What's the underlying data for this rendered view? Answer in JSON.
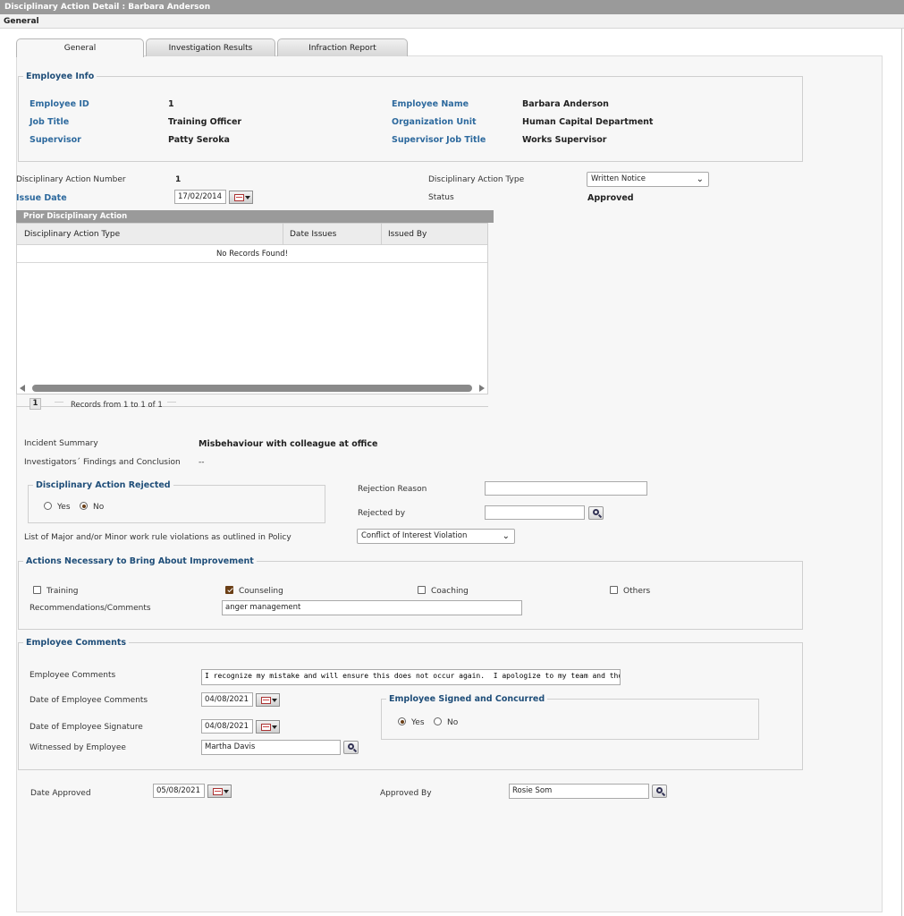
{
  "window": {
    "title": "Disciplinary Action Detail : Barbara Anderson",
    "section": "General"
  },
  "tabs": [
    {
      "label": "General"
    },
    {
      "label": "Investigation Results"
    },
    {
      "label": "Infraction Report"
    }
  ],
  "employee_info": {
    "legend": "Employee Info",
    "employee_id_label": "Employee ID",
    "employee_id": "1",
    "employee_name_label": "Employee Name",
    "employee_name": "Barbara Anderson",
    "job_title_label": "Job Title",
    "job_title": "Training Officer",
    "org_unit_label": "Organization Unit",
    "org_unit": "Human Capital Department",
    "supervisor_label": "Supervisor",
    "supervisor": "Patty Seroka",
    "supervisor_job_title_label": "Supervisor Job Title",
    "supervisor_job_title": "Works Supervisor"
  },
  "action": {
    "number_label": "Disciplinary Action Number",
    "number": "1",
    "type_label": "Disciplinary Action Type",
    "type": "Written Notice",
    "issue_date_label": "Issue Date",
    "issue_date": "17/02/2014",
    "status_label": "Status",
    "status": "Approved"
  },
  "prior": {
    "title": "Prior Disciplinary Action",
    "columns": [
      "Disciplinary Action Type",
      "Date Issues",
      "Issued By"
    ],
    "empty_text": "No Records Found!",
    "page": "1",
    "records_text": "Records from 1 to 1 of 1"
  },
  "incident": {
    "summary_label": "Incident Summary",
    "summary": "Misbehaviour with colleague at office",
    "findings_label": "Investigators´ Findings and Conclusion",
    "findings": "--"
  },
  "rejected": {
    "legend": "Disciplinary Action Rejected",
    "yes": "Yes",
    "no": "No",
    "reason_label": "Rejection Reason",
    "reason": "",
    "by_label": "Rejected by",
    "by": ""
  },
  "violations": {
    "label": "List of Major and/or Minor work rule violations as outlined in Policy",
    "value": "Conflict of Interest Violation"
  },
  "improvement": {
    "legend": "Actions Necessary to Bring About Improvement",
    "training": "Training",
    "counseling": "Counseling",
    "coaching": "Coaching",
    "others": "Others",
    "recommendations_label": "Recommendations/Comments",
    "recommendations": "anger management"
  },
  "comments": {
    "legend": "Employee Comments",
    "comments_label": "Employee Comments",
    "comments": "I recognize my mistake and will ensure this does not occur again.  I apologize to my team and those I have let down.",
    "date_comments_label": "Date of Employee Comments",
    "date_comments": "04/08/2021",
    "date_signature_label": "Date of Employee Signature",
    "date_signature": "04/08/2021",
    "witnessed_label": "Witnessed by Employee",
    "witnessed": "Martha Davis",
    "signed_legend": "Employee Signed and Concurred",
    "yes": "Yes",
    "no": "No"
  },
  "approval": {
    "date_label": "Date Approved",
    "date": "05/08/2021",
    "by_label": "Approved By",
    "by": "Rosie Som"
  }
}
